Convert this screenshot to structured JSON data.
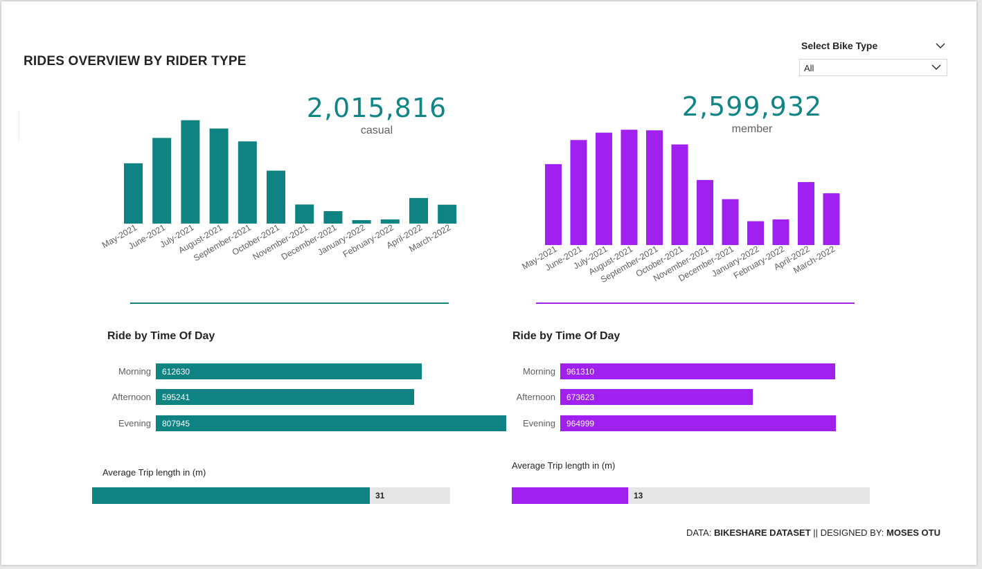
{
  "title": "RIDES OVERVIEW BY RIDER TYPE",
  "slicer": {
    "title": "Select Bike Type",
    "value": "All",
    "icon": "chevron-down-icon"
  },
  "colors": {
    "casual": "#0F8282",
    "member": "#A020F0",
    "gauge_track": "#E6E6E6"
  },
  "panels": {
    "casual": {
      "kpi_value": "2,015,816",
      "kpi_label": "casual",
      "time_title": "Ride by Time Of Day",
      "time_of_day": [
        {
          "label": "Morning",
          "value": "612630"
        },
        {
          "label": "Afternoon",
          "value": "595241"
        },
        {
          "label": "Evening",
          "value": "807945"
        }
      ],
      "avg_title": "Average Trip length in (m)",
      "avg_value": "31"
    },
    "member": {
      "kpi_value": "2,599,932",
      "kpi_label": "member",
      "time_title": "Ride by Time Of Day",
      "time_of_day": [
        {
          "label": "Morning",
          "value": "961310"
        },
        {
          "label": "Afternoon",
          "value": "673623"
        },
        {
          "label": "Evening",
          "value": "964999"
        }
      ],
      "avg_title": "Average Trip length in (m)",
      "avg_value": "13"
    }
  },
  "footer": {
    "prefix": "DATA: ",
    "data_source": "BIKESHARE DATASET",
    "middle": " || DESIGNED BY: ",
    "designer": "MOSES OTU"
  },
  "chart_data": [
    {
      "type": "bar",
      "series": [
        {
          "name": "casual",
          "values": [
            262000,
            372000,
            449000,
            413000,
            357000,
            230000,
            83000,
            54000,
            15000,
            18000,
            111000,
            82000
          ]
        }
      ],
      "categories": [
        "May-2021",
        "June-2021",
        "July-2021",
        "August-2021",
        "September-2021",
        "October-2021",
        "November-2021",
        "December-2021",
        "January-2022",
        "February-2022",
        "April-2022",
        "March-2022"
      ],
      "ylim": [
        0,
        460000
      ],
      "grid": false
    },
    {
      "type": "bar",
      "series": [
        {
          "name": "member",
          "values": [
            275000,
            357000,
            382000,
            392000,
            390000,
            342000,
            221000,
            156000,
            81000,
            87000,
            214000,
            176000
          ]
        }
      ],
      "categories": [
        "May-2021",
        "June-2021",
        "July-2021",
        "August-2021",
        "September-2021",
        "October-2021",
        "November-2021",
        "December-2021",
        "January-2022",
        "February-2022",
        "April-2022",
        "March-2022"
      ],
      "ylim": [
        0,
        400000
      ],
      "grid": false
    },
    {
      "type": "bar",
      "orientation": "horizontal",
      "series": [
        {
          "name": "casual",
          "values": [
            612630,
            595241,
            807945
          ]
        }
      ],
      "categories": [
        "Morning",
        "Afternoon",
        "Evening"
      ],
      "xlim": [
        0,
        830000
      ]
    },
    {
      "type": "bar",
      "orientation": "horizontal",
      "series": [
        {
          "name": "member",
          "values": [
            961310,
            673623,
            964999
          ]
        }
      ],
      "categories": [
        "Morning",
        "Afternoon",
        "Evening"
      ],
      "xlim": [
        0,
        1260000
      ]
    },
    {
      "type": "bar",
      "orientation": "horizontal",
      "series": [
        {
          "name": "casual",
          "values": [
            31
          ]
        },
        {
          "name": "member",
          "values": [
            13
          ]
        }
      ],
      "categories": [
        "Average Trip length in (m)"
      ],
      "xlim": [
        0,
        40
      ]
    }
  ]
}
